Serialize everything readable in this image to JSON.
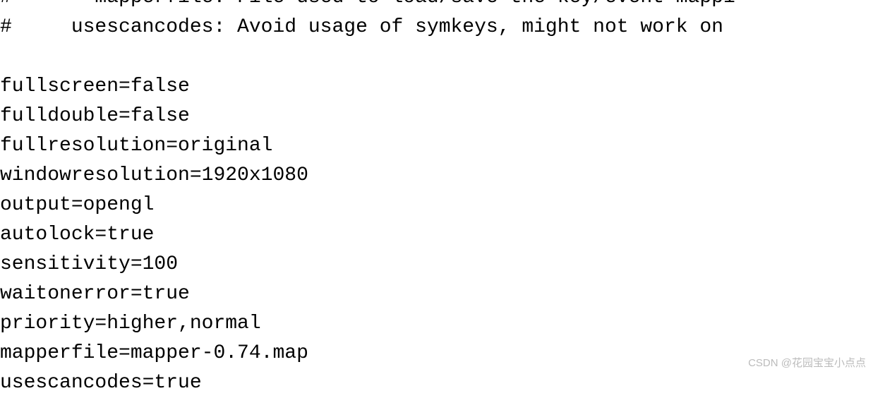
{
  "comments": {
    "line1": "#       mapperfile: File used to load/save the key/event mappi",
    "line2": "#     usescancodes: Avoid usage of symkeys, might not work on "
  },
  "config": {
    "fullscreen": "fullscreen=false",
    "fulldouble": "fulldouble=false",
    "fullresolution": "fullresolution=original",
    "windowresolution": "windowresolution=1920x1080",
    "output": "output=opengl",
    "autolock": "autolock=true",
    "sensitivity": "sensitivity=100",
    "waitonerror": "waitonerror=true",
    "priority": "priority=higher,normal",
    "mapperfile": "mapperfile=mapper-0.74.map",
    "usescancodes": "usescancodes=true"
  },
  "watermark": "CSDN @花园宝宝小点点"
}
